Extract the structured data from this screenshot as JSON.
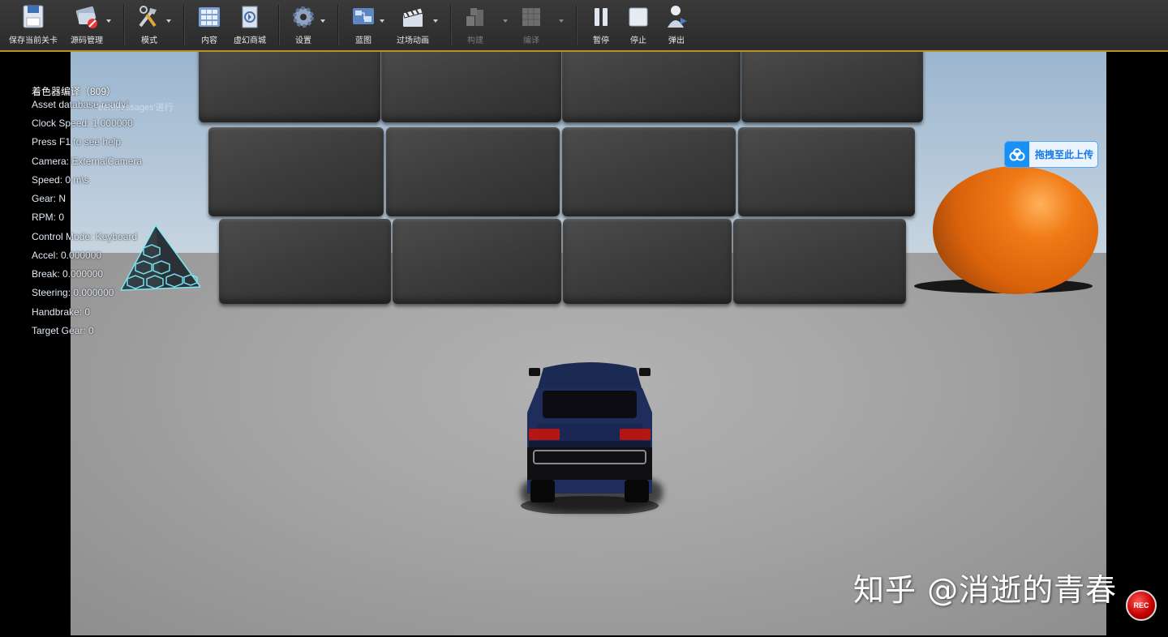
{
  "toolbar": {
    "items": [
      {
        "label": "保存当前关卡",
        "icon": "save-icon"
      },
      {
        "label": "源码管理",
        "icon": "source-control-icon"
      },
      {
        "label": "模式",
        "icon": "modes-icon"
      },
      {
        "label": "内容",
        "icon": "content-icon"
      },
      {
        "label": "虚幻商城",
        "icon": "marketplace-icon"
      },
      {
        "label": "设置",
        "icon": "settings-icon"
      },
      {
        "label": "蓝图",
        "icon": "blueprint-icon"
      },
      {
        "label": "过场动画",
        "icon": "cinematics-icon"
      },
      {
        "label": "构建",
        "icon": "build-icon"
      },
      {
        "label": "编译",
        "icon": "compile-icon"
      },
      {
        "label": "暂停",
        "icon": "pause-icon"
      },
      {
        "label": "停止",
        "icon": "stop-icon"
      },
      {
        "label": "弹出",
        "icon": "eject-icon"
      }
    ]
  },
  "overlay": {
    "shader_title": "着色器编译（809）",
    "ghost_text": "eenMessages'进行",
    "lines": [
      "Asset database ready!",
      "Clock Speed: 1.000000",
      "Press F1 to see help",
      "Camera: ExternalCamera",
      "Speed: 0 m\\s",
      "Gear: N",
      "RPM: 0",
      "Control Mode: Keyboard",
      "Accel: 0.000000",
      "Break: 0.000000",
      "Steering: 0.000000",
      "Handbrake: 0",
      "Target Gear: 0"
    ]
  },
  "upload_widget": {
    "label": "拖拽至此上传",
    "icon": "cloud-upload-icon"
  },
  "watermark": {
    "text": "知乎 @消逝的青春"
  },
  "rec_button": {
    "label": "REC"
  },
  "colors": {
    "accent": "#b8902a",
    "toolbar_bg": "#2f2f2f",
    "egg": "#f07a16",
    "upload_blue": "#1890f5"
  }
}
